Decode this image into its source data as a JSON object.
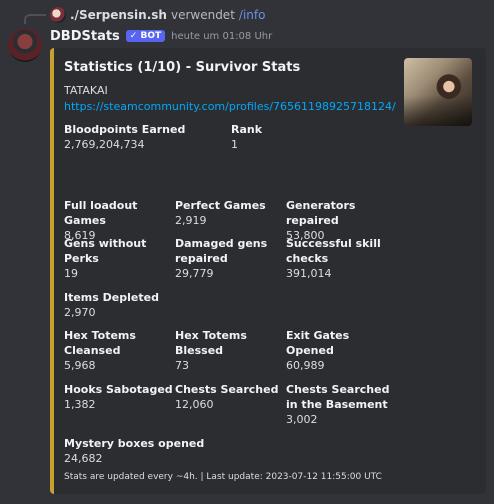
{
  "reply": {
    "username": "./Serpensin.sh",
    "verb": "verwendet",
    "command": "/info"
  },
  "message": {
    "bot_name": "DBDStats",
    "badge": "✓ BOT",
    "timestamp": "heute um 01:08 Uhr"
  },
  "embed": {
    "accent_color": "#c99f2f",
    "title": "Statistics (1/10) - Survivor Stats",
    "player_name": "TATAKAI",
    "profile_link": "https://steamcommunity.com/profiles/76561198925718124/",
    "fields": [
      {
        "name": "Bloodpoints Earned",
        "value": "2,769,204,734"
      },
      {
        "name": "Rank",
        "value": "1"
      },
      {
        "name": "Full loadout Games",
        "value": "8,619"
      },
      {
        "name": "Perfect Games",
        "value": "2,919"
      },
      {
        "name": "Generators repaired",
        "value": "53,800"
      },
      {
        "name": "Gens without Perks",
        "value": "19"
      },
      {
        "name": "Damaged gens repaired",
        "value": "29,779"
      },
      {
        "name": "Successful skill checks",
        "value": "391,014"
      },
      {
        "name": "Items Depleted",
        "value": "2,970"
      },
      {
        "name": "Hex Totems Cleansed",
        "value": "5,968"
      },
      {
        "name": "Hex Totems Blessed",
        "value": "73"
      },
      {
        "name": "Exit Gates Opened",
        "value": "60,989"
      },
      {
        "name": "Hooks Sabotaged",
        "value": "1,382"
      },
      {
        "name": "Chests Searched",
        "value": "12,060"
      },
      {
        "name": "Chests Searched in the Basement",
        "value": "3,002"
      },
      {
        "name": "Mystery boxes opened",
        "value": "24,682"
      }
    ],
    "footer": "Stats are updated every ~4h. | Last update: 2023-07-12 11:55:00 UTC"
  }
}
